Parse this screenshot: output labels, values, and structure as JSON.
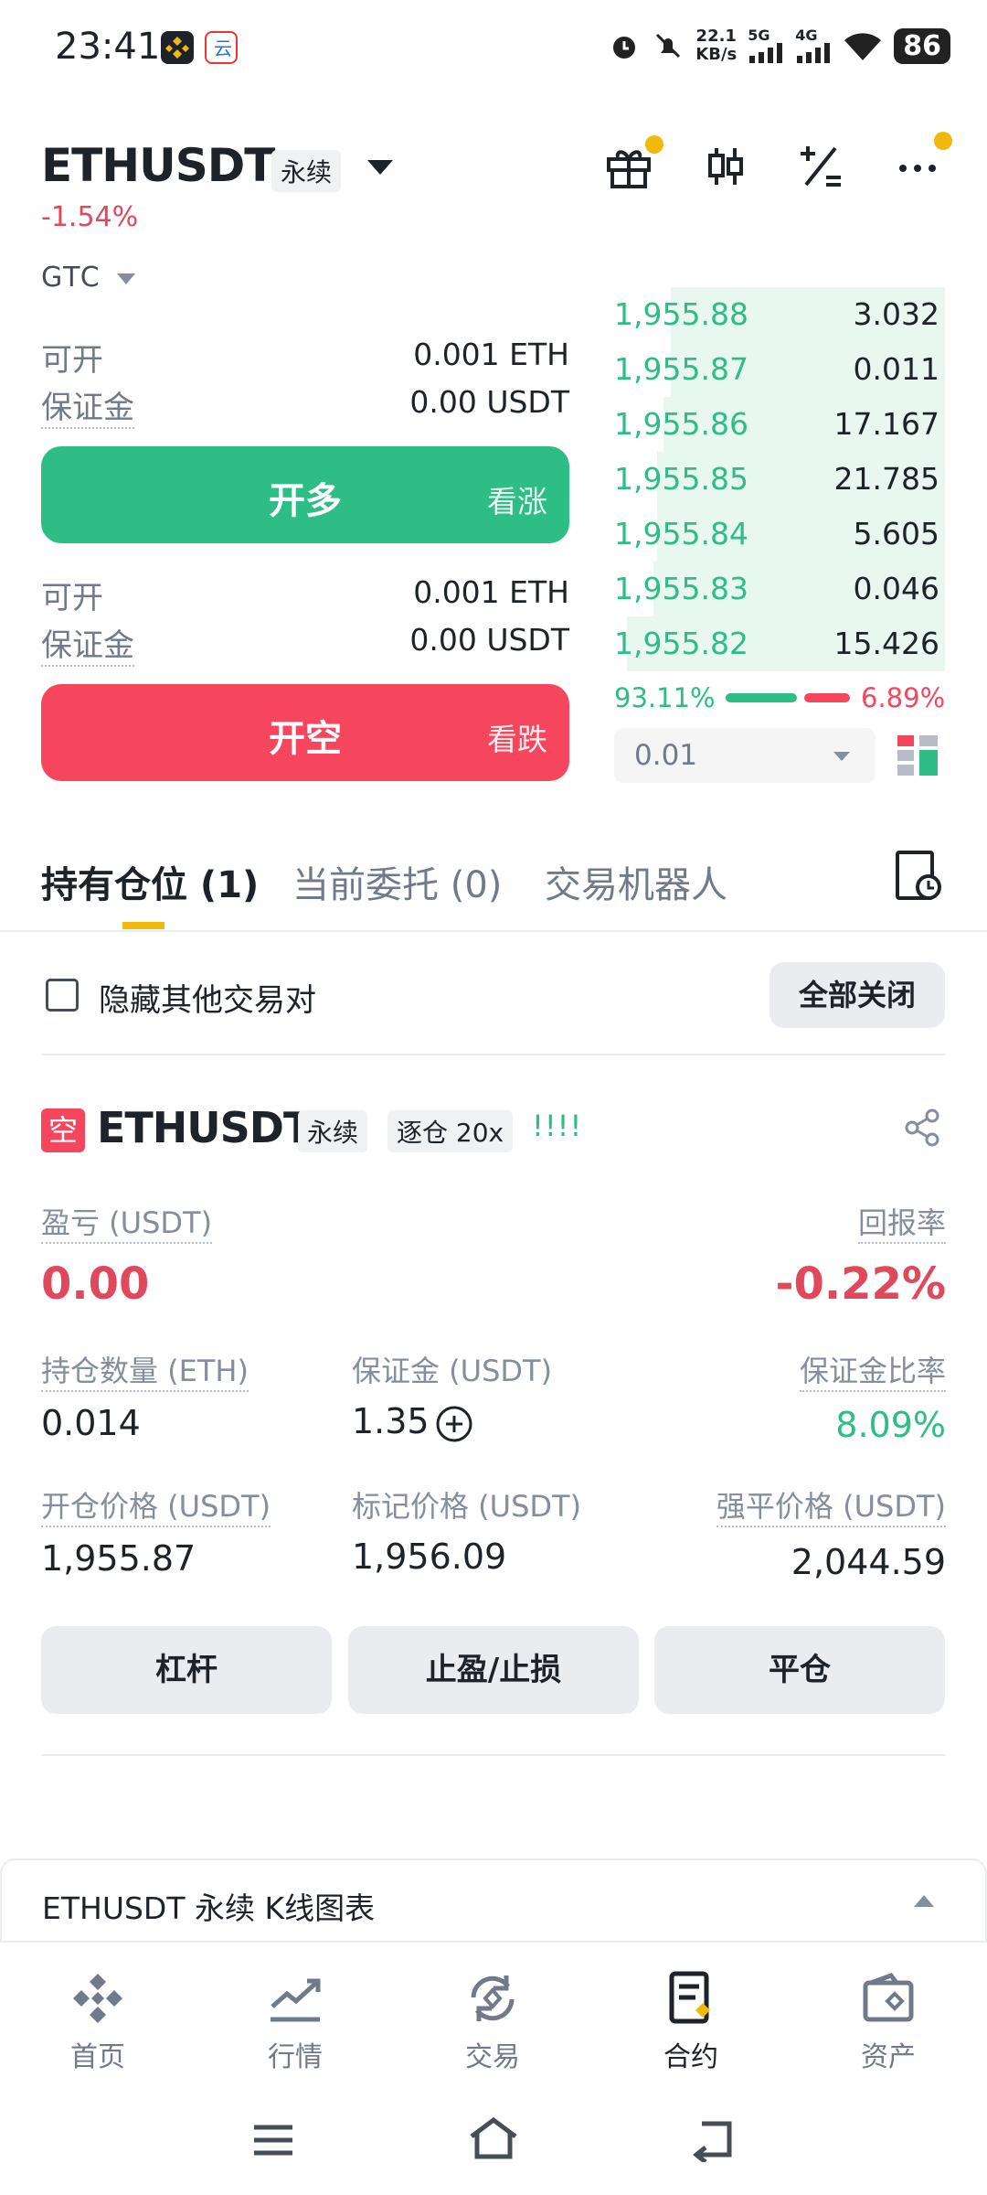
{
  "status_bar": {
    "time": "23:41",
    "speed": "22.1",
    "speed_unit": "KB/s",
    "net1": "5G",
    "net2": "4G",
    "battery": "86"
  },
  "header": {
    "symbol": "ETHUSDT",
    "contract_tag": "永续",
    "change": "-1.54%"
  },
  "order_panel": {
    "tif": "GTC",
    "long": {
      "avail_label": "可开",
      "avail_value": "0.001 ETH",
      "margin_label": "保证金",
      "margin_value": "0.00 USDT",
      "button": "开多",
      "button_sub": "看涨"
    },
    "short": {
      "avail_label": "可开",
      "avail_value": "0.001 ETH",
      "margin_label": "保证金",
      "margin_value": "0.00 USDT",
      "button": "开空",
      "button_sub": "看跌"
    }
  },
  "orderbook": {
    "rows": [
      {
        "price": "1,955.88",
        "qty": "3.032",
        "depth": 0.83
      },
      {
        "price": "1,955.87",
        "qty": "0.011",
        "depth": 0.83
      },
      {
        "price": "1,955.86",
        "qty": "17.167",
        "depth": 0.85
      },
      {
        "price": "1,955.85",
        "qty": "21.785",
        "depth": 0.87
      },
      {
        "price": "1,955.84",
        "qty": "5.605",
        "depth": 0.87
      },
      {
        "price": "1,955.83",
        "qty": "0.046",
        "depth": 0.88
      },
      {
        "price": "1,955.82",
        "qty": "15.426",
        "depth": 0.96
      }
    ],
    "buy_ratio": "93.11%",
    "sell_ratio": "6.89%",
    "buy_fraction": 0.6,
    "precision": "0.01"
  },
  "tabs": [
    {
      "label": "持有仓位 (1)"
    },
    {
      "label": "当前委托 (0)"
    },
    {
      "label": "交易机器人"
    }
  ],
  "filter": {
    "hide_label": "隐藏其他交易对",
    "close_all": "全部关闭"
  },
  "position": {
    "side_badge": "空",
    "symbol": "ETHUSDT",
    "contract_tag": "永续",
    "margin_tag": "逐仓 20x",
    "adl": "!!!!",
    "pnl_label": "盈亏 (USDT)",
    "pnl_value": "0.00",
    "roe_label": "回报率",
    "roe_value": "-0.22%",
    "size_label": "持仓数量 (ETH)",
    "size_value": "0.014",
    "margin_label": "保证金 (USDT)",
    "margin_value": "1.35",
    "margin_ratio_label": "保证金比率",
    "margin_ratio_value": "8.09%",
    "entry_label": "开仓价格 (USDT)",
    "entry_value": "1,955.87",
    "mark_label": "标记价格 (USDT)",
    "mark_value": "1,956.09",
    "liq_label": "强平价格 (USDT)",
    "liq_value": "2,044.59",
    "buttons": [
      "杠杆",
      "止盈/止损",
      "平仓"
    ]
  },
  "chart_section": {
    "title": "ETHUSDT 永续 K线图表"
  },
  "nav": [
    {
      "label": "首页"
    },
    {
      "label": "行情"
    },
    {
      "label": "交易"
    },
    {
      "label": "合约"
    },
    {
      "label": "资产"
    }
  ],
  "colors": {
    "green": "#2ebd85",
    "red": "#f6465d",
    "yellow": "#f0b90b",
    "text": "#1e2329",
    "muted": "#707a8a"
  }
}
